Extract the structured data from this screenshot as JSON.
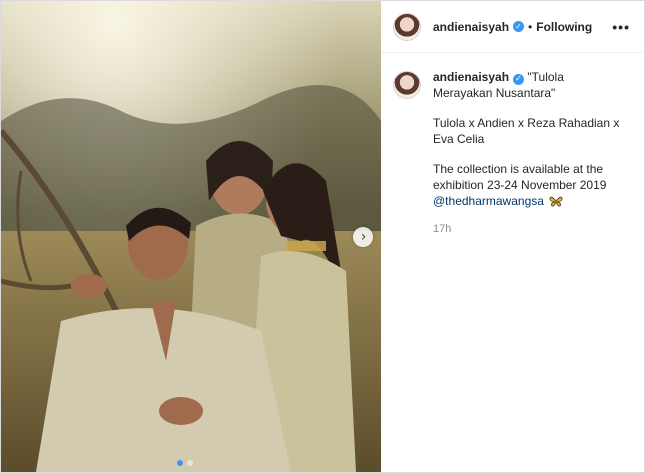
{
  "post": {
    "username": "andienaisyah",
    "separator": "•",
    "follow_label": "Following",
    "more_label": "•••",
    "caption": {
      "title": "\"Tulola Merayakan Nusantara\"",
      "credits": "Tulola x Andien x Reza Rahadian x Eva Celia",
      "info": "The collection is available at the exhibition 23-24 November 2019",
      "mention": "@thedharmawangsa",
      "emoji": "butterfly"
    },
    "timestamp": "17h"
  },
  "carousel": {
    "next_label": "›",
    "slide_count": 2,
    "active_index": 0
  },
  "colors": {
    "verified": "#3897f0",
    "mention": "#00376b",
    "timestamp": "#8e8e8e",
    "active_dot": "#3897f0"
  }
}
